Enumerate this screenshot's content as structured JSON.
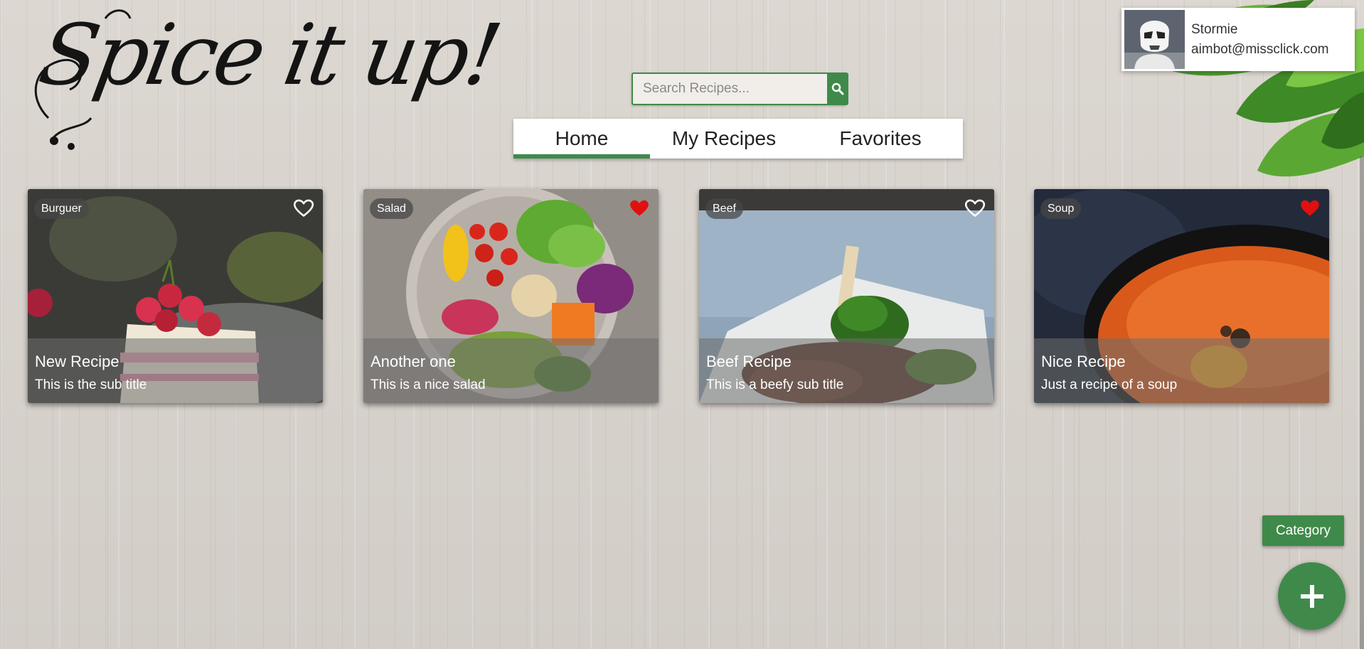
{
  "app": {
    "logo_text": "Spice it up!"
  },
  "search": {
    "placeholder": "Search Recipes...",
    "value": "",
    "button_icon": "search-icon"
  },
  "nav": {
    "tabs": [
      {
        "label": "Home",
        "active": true
      },
      {
        "label": "My Recipes",
        "active": false
      },
      {
        "label": "Favorites",
        "active": false
      }
    ]
  },
  "user": {
    "name": "Stormie",
    "email": "aimbot@missclick.com",
    "avatar_icon": "stormtrooper-avatar"
  },
  "recipes": [
    {
      "category": "Burguer",
      "title": "New Recipe",
      "subtitle": "This is the sub title",
      "favorite": false
    },
    {
      "category": "Salad",
      "title": "Another one",
      "subtitle": "This is a nice salad",
      "favorite": true
    },
    {
      "category": "Beef",
      "title": "Beef Recipe",
      "subtitle": "This is a beefy sub title",
      "favorite": false
    },
    {
      "category": "Soup",
      "title": "Nice Recipe",
      "subtitle": "Just a recipe of a soup",
      "favorite": true
    }
  ],
  "actions": {
    "category_label": "Category",
    "add_icon": "plus-icon"
  },
  "colors": {
    "accent": "#3f8a4a",
    "favorite": "#e01010"
  }
}
